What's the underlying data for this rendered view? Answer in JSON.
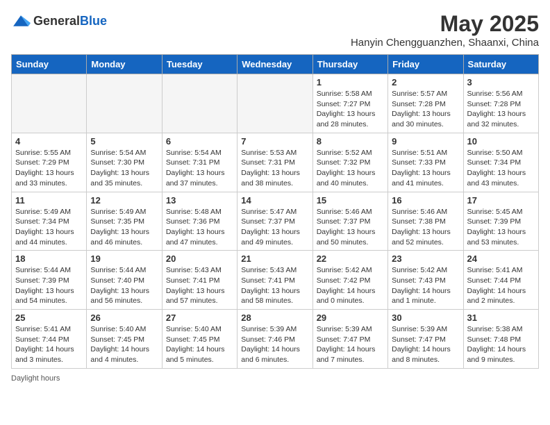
{
  "header": {
    "logo_general": "General",
    "logo_blue": "Blue",
    "month_title": "May 2025",
    "location": "Hanyin Chengguanzhen, Shaanxi, China"
  },
  "weekdays": [
    "Sunday",
    "Monday",
    "Tuesday",
    "Wednesday",
    "Thursday",
    "Friday",
    "Saturday"
  ],
  "footer": {
    "note": "Daylight hours"
  },
  "weeks": [
    [
      {
        "day": "",
        "empty": true
      },
      {
        "day": "",
        "empty": true
      },
      {
        "day": "",
        "empty": true
      },
      {
        "day": "",
        "empty": true
      },
      {
        "day": "1",
        "sunrise": "5:58 AM",
        "sunset": "7:27 PM",
        "daylight": "13 hours and 28 minutes."
      },
      {
        "day": "2",
        "sunrise": "5:57 AM",
        "sunset": "7:28 PM",
        "daylight": "13 hours and 30 minutes."
      },
      {
        "day": "3",
        "sunrise": "5:56 AM",
        "sunset": "7:28 PM",
        "daylight": "13 hours and 32 minutes."
      }
    ],
    [
      {
        "day": "4",
        "sunrise": "5:55 AM",
        "sunset": "7:29 PM",
        "daylight": "13 hours and 33 minutes."
      },
      {
        "day": "5",
        "sunrise": "5:54 AM",
        "sunset": "7:30 PM",
        "daylight": "13 hours and 35 minutes."
      },
      {
        "day": "6",
        "sunrise": "5:54 AM",
        "sunset": "7:31 PM",
        "daylight": "13 hours and 37 minutes."
      },
      {
        "day": "7",
        "sunrise": "5:53 AM",
        "sunset": "7:31 PM",
        "daylight": "13 hours and 38 minutes."
      },
      {
        "day": "8",
        "sunrise": "5:52 AM",
        "sunset": "7:32 PM",
        "daylight": "13 hours and 40 minutes."
      },
      {
        "day": "9",
        "sunrise": "5:51 AM",
        "sunset": "7:33 PM",
        "daylight": "13 hours and 41 minutes."
      },
      {
        "day": "10",
        "sunrise": "5:50 AM",
        "sunset": "7:34 PM",
        "daylight": "13 hours and 43 minutes."
      }
    ],
    [
      {
        "day": "11",
        "sunrise": "5:49 AM",
        "sunset": "7:34 PM",
        "daylight": "13 hours and 44 minutes."
      },
      {
        "day": "12",
        "sunrise": "5:49 AM",
        "sunset": "7:35 PM",
        "daylight": "13 hours and 46 minutes."
      },
      {
        "day": "13",
        "sunrise": "5:48 AM",
        "sunset": "7:36 PM",
        "daylight": "13 hours and 47 minutes."
      },
      {
        "day": "14",
        "sunrise": "5:47 AM",
        "sunset": "7:37 PM",
        "daylight": "13 hours and 49 minutes."
      },
      {
        "day": "15",
        "sunrise": "5:46 AM",
        "sunset": "7:37 PM",
        "daylight": "13 hours and 50 minutes."
      },
      {
        "day": "16",
        "sunrise": "5:46 AM",
        "sunset": "7:38 PM",
        "daylight": "13 hours and 52 minutes."
      },
      {
        "day": "17",
        "sunrise": "5:45 AM",
        "sunset": "7:39 PM",
        "daylight": "13 hours and 53 minutes."
      }
    ],
    [
      {
        "day": "18",
        "sunrise": "5:44 AM",
        "sunset": "7:39 PM",
        "daylight": "13 hours and 54 minutes."
      },
      {
        "day": "19",
        "sunrise": "5:44 AM",
        "sunset": "7:40 PM",
        "daylight": "13 hours and 56 minutes."
      },
      {
        "day": "20",
        "sunrise": "5:43 AM",
        "sunset": "7:41 PM",
        "daylight": "13 hours and 57 minutes."
      },
      {
        "day": "21",
        "sunrise": "5:43 AM",
        "sunset": "7:41 PM",
        "daylight": "13 hours and 58 minutes."
      },
      {
        "day": "22",
        "sunrise": "5:42 AM",
        "sunset": "7:42 PM",
        "daylight": "14 hours and 0 minutes."
      },
      {
        "day": "23",
        "sunrise": "5:42 AM",
        "sunset": "7:43 PM",
        "daylight": "14 hours and 1 minute."
      },
      {
        "day": "24",
        "sunrise": "5:41 AM",
        "sunset": "7:44 PM",
        "daylight": "14 hours and 2 minutes."
      }
    ],
    [
      {
        "day": "25",
        "sunrise": "5:41 AM",
        "sunset": "7:44 PM",
        "daylight": "14 hours and 3 minutes."
      },
      {
        "day": "26",
        "sunrise": "5:40 AM",
        "sunset": "7:45 PM",
        "daylight": "14 hours and 4 minutes."
      },
      {
        "day": "27",
        "sunrise": "5:40 AM",
        "sunset": "7:45 PM",
        "daylight": "14 hours and 5 minutes."
      },
      {
        "day": "28",
        "sunrise": "5:39 AM",
        "sunset": "7:46 PM",
        "daylight": "14 hours and 6 minutes."
      },
      {
        "day": "29",
        "sunrise": "5:39 AM",
        "sunset": "7:47 PM",
        "daylight": "14 hours and 7 minutes."
      },
      {
        "day": "30",
        "sunrise": "5:39 AM",
        "sunset": "7:47 PM",
        "daylight": "14 hours and 8 minutes."
      },
      {
        "day": "31",
        "sunrise": "5:38 AM",
        "sunset": "7:48 PM",
        "daylight": "14 hours and 9 minutes."
      }
    ]
  ]
}
